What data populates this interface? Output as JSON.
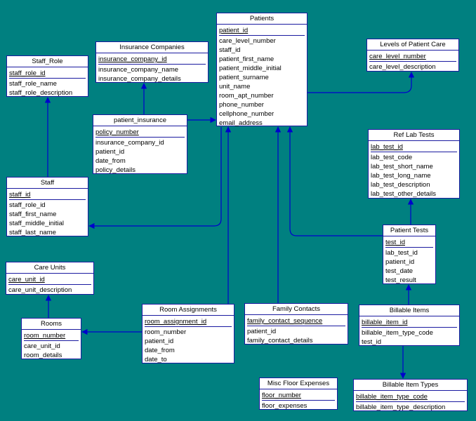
{
  "diagram": {
    "entities": {
      "patients": {
        "title": "Patients",
        "attributes": [
          "patient_id",
          "care_level_number",
          "staff_id",
          "patient_first_name",
          "patient_middle_initial",
          "patient_surname",
          "unit_name",
          "room_apt_number",
          "phone_number",
          "cellphone_number",
          "email_address"
        ]
      },
      "insurance_companies": {
        "title": "Insurance Companies",
        "attributes": [
          "insurance_company_id",
          "insurance_company_name",
          "insurance_company_details"
        ]
      },
      "staff_role": {
        "title": "Staff_Role",
        "attributes": [
          "staff_role_id",
          "staff_role_name",
          "staff_role_description"
        ]
      },
      "levels_of_patient_care": {
        "title": "Levels of Patient Care",
        "attributes": [
          "care_level_number",
          "care_level_description"
        ]
      },
      "patient_insurance": {
        "title": "patient_insurance",
        "attributes": [
          "policy_number",
          "insurance_company_id",
          "patient_id",
          "date_from",
          "policy_details"
        ]
      },
      "ref_lab_tests": {
        "title": "Ref Lab Tests",
        "attributes": [
          "lab_test_id",
          "lab_test_code",
          "lab_test_short_name",
          "lab_test_long_name",
          "lab_test_description",
          "lab_test_other_details"
        ]
      },
      "staff": {
        "title": "Staff",
        "attributes": [
          "staff_id",
          "staff_role_id",
          "staff_first_name",
          "staff_middle_initial",
          "staff_last_name"
        ]
      },
      "patient_tests": {
        "title": "Patient Tests",
        "attributes": [
          "test_id",
          "lab_test_id",
          "patient_id",
          "test_date",
          "test_result"
        ]
      },
      "care_units": {
        "title": "Care Units",
        "attributes": [
          "care_unit_id",
          "care_unit_description"
        ]
      },
      "room_assignments": {
        "title": "Room Assignments",
        "attributes": [
          "room_assignment_id",
          "room_number",
          "patient_id",
          "date_from",
          "date_to"
        ]
      },
      "family_contacts": {
        "title": "Family Contacts",
        "attributes": [
          "family_contact_sequence",
          "patient_id",
          "family_contact_details"
        ]
      },
      "billable_items": {
        "title": "Billable Items",
        "attributes": [
          "billable_item_id",
          "billable_item_type_code",
          "test_id"
        ]
      },
      "rooms": {
        "title": "Rooms",
        "attributes": [
          "room_number",
          "care_unit_id",
          "room_details"
        ]
      },
      "misc_floor_expenses": {
        "title": "Misc Floor Expenses",
        "attributes": [
          "floor_number",
          "floor_expenses"
        ]
      },
      "billable_item_types": {
        "title": "Billable Item Types",
        "attributes": [
          "billable_item_type_code",
          "billable_item_type_description"
        ]
      }
    },
    "colors": {
      "background": "#008080",
      "entity_fill": "#ffffff",
      "line": "#0000cc"
    }
  }
}
